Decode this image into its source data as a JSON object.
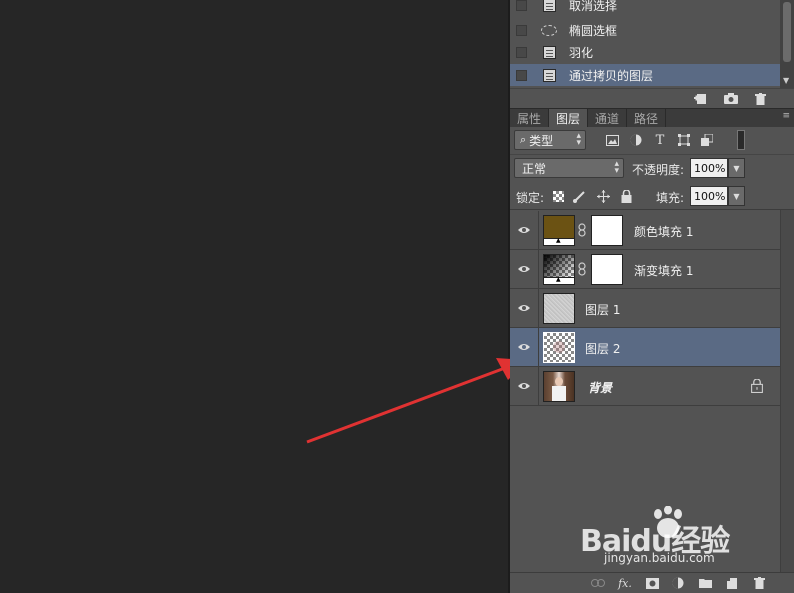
{
  "history": {
    "items": [
      {
        "label": "取消选择",
        "icon": "document-icon",
        "selected": false
      },
      {
        "label": "椭圆选框",
        "icon": "ellipse-icon",
        "selected": false
      },
      {
        "label": "羽化",
        "icon": "document-icon",
        "selected": false
      },
      {
        "label": "通过拷贝的图层",
        "icon": "document-icon",
        "selected": true
      }
    ],
    "footer_icons": [
      "new-document-from-state-icon",
      "camera-snapshot-icon",
      "trash-icon"
    ]
  },
  "tabs": [
    {
      "label": "属性",
      "active": false
    },
    {
      "label": "图层",
      "active": true
    },
    {
      "label": "通道",
      "active": false
    },
    {
      "label": "路径",
      "active": false
    }
  ],
  "filter": {
    "kind_label": "类型",
    "icons": [
      "image-filter-icon",
      "adjustment-filter-icon",
      "text-filter-icon",
      "shape-filter-icon",
      "smart-object-filter-icon"
    ]
  },
  "blend": {
    "mode": "正常",
    "opacity_label": "不透明度:",
    "opacity_value": "100%"
  },
  "lock": {
    "label": "锁定:",
    "fill_label": "填充:",
    "fill_value": "100%"
  },
  "layers": [
    {
      "name": "颜色填充 1",
      "type": "fill",
      "swatch": "#6b5213",
      "has_mask": true,
      "selected": false,
      "locked": false
    },
    {
      "name": "渐变填充 1",
      "type": "gradient",
      "has_mask": true,
      "selected": false,
      "locked": false
    },
    {
      "name": "图层 1",
      "type": "noise",
      "has_mask": false,
      "selected": false,
      "locked": false
    },
    {
      "name": "图层 2",
      "type": "transparent",
      "has_mask": false,
      "selected": true,
      "locked": false
    },
    {
      "name": "背景",
      "type": "photo",
      "has_mask": false,
      "selected": false,
      "locked": true
    }
  ],
  "layers_footer_icons": [
    "link-layers-icon",
    "fx-icon",
    "add-mask-icon",
    "adjustment-layer-icon",
    "new-group-icon",
    "new-layer-icon",
    "delete-layer-icon"
  ],
  "watermark": {
    "logo": "Baidu经验",
    "url": "jingyan.baidu.com"
  },
  "colors": {
    "panel": "#535353",
    "selected": "#5a6a84",
    "canvas": "#262626",
    "arrow": "#e03232"
  }
}
